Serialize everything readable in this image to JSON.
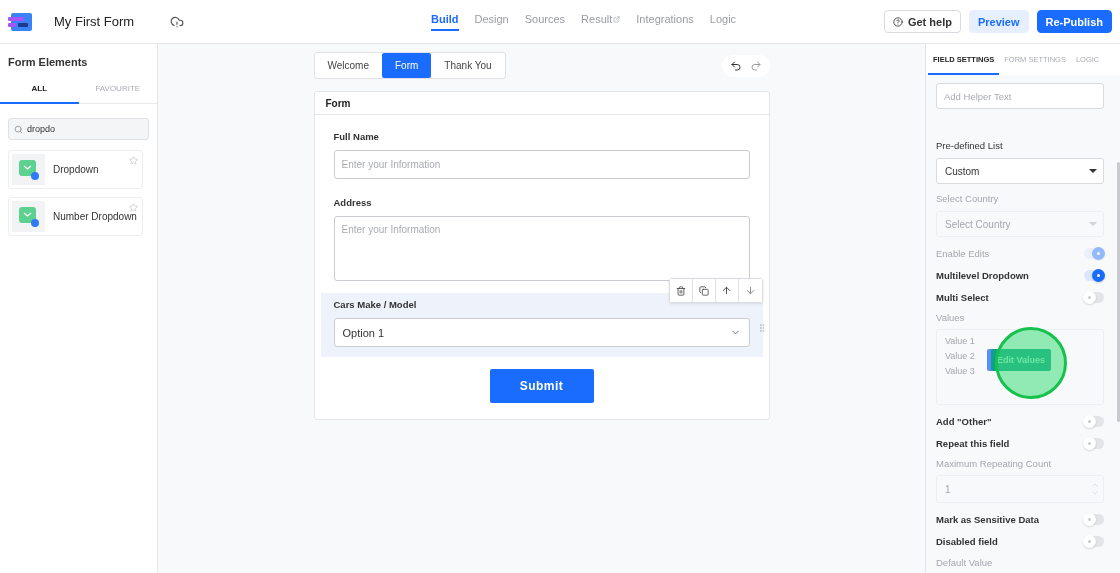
{
  "header": {
    "form_title": "My First Form",
    "nav": [
      {
        "label": "Build",
        "selected": true,
        "external": false
      },
      {
        "label": "Design",
        "selected": false,
        "external": false
      },
      {
        "label": "Sources",
        "selected": false,
        "external": false
      },
      {
        "label": "Result",
        "selected": false,
        "external": true
      },
      {
        "label": "Integrations",
        "selected": false,
        "external": false
      },
      {
        "label": "Logic",
        "selected": false,
        "external": false
      }
    ],
    "buttons": [
      {
        "label": "Get help",
        "kind": "outline"
      },
      {
        "label": "Preview",
        "kind": "soft"
      },
      {
        "label": "Re-Publish",
        "kind": "primary"
      }
    ]
  },
  "sidebar": {
    "title": "Form Elements",
    "tabs": [
      {
        "label": "ALL",
        "selected": true
      },
      {
        "label": "FAVOURITE",
        "selected": false
      }
    ],
    "search": {
      "value": "dropdo"
    },
    "items": [
      {
        "label": "Dropdown"
      },
      {
        "label": "Number Dropdown"
      }
    ]
  },
  "canvas": {
    "steps": [
      {
        "label": "Welcome",
        "selected": false
      },
      {
        "label": "Form",
        "selected": true
      },
      {
        "label": "Thank You",
        "selected": false
      }
    ],
    "form": {
      "title": "Form",
      "fields": [
        {
          "kind": "input",
          "label": "Full Name",
          "placeholder": "Enter your Information",
          "selected": false
        },
        {
          "kind": "textarea",
          "label": "Address",
          "placeholder": "Enter your Information",
          "selected": false
        },
        {
          "kind": "select",
          "label": "Cars Make / Model",
          "value": "Option 1",
          "selected": true
        }
      ],
      "submit": "Submit"
    }
  },
  "settings": {
    "tabs": [
      {
        "label": "FIELD SETTINGS",
        "selected": true
      },
      {
        "label": "FORM SETTINGS",
        "selected": false
      },
      {
        "label": "LOGIC",
        "selected": false
      }
    ],
    "items": [
      {
        "kind": "input",
        "placeholder": "Add Helper Text"
      },
      {
        "kind": "select",
        "label": "Pre-defined List",
        "value": "Custom",
        "disabled": false
      },
      {
        "kind": "select",
        "label": "Select Country",
        "placeholder": "Select Country",
        "disabled": true
      },
      {
        "kind": "toggle",
        "label": "Enable Edits",
        "on": true,
        "disabled": true
      },
      {
        "kind": "toggle",
        "label": "Multilevel Dropdown",
        "on": true,
        "disabled": false
      },
      {
        "kind": "toggle",
        "label": "Multi Select",
        "on": false,
        "disabled": false
      },
      {
        "kind": "values",
        "label": "Values",
        "values": [
          "Value 1",
          "Value 2",
          "Value 3"
        ],
        "button": "Edit Values"
      },
      {
        "kind": "toggle",
        "label": "Add \"Other\"",
        "on": false,
        "disabled": false
      },
      {
        "kind": "toggle",
        "label": "Repeat this field",
        "on": false,
        "disabled": false
      },
      {
        "kind": "number",
        "label": "Maximum Repeating Count",
        "value": "1"
      },
      {
        "kind": "toggle",
        "label": "Mark as Sensitive Data",
        "on": false,
        "disabled": false
      },
      {
        "kind": "toggle",
        "label": "Disabled field",
        "on": false,
        "disabled": false
      },
      {
        "kind": "label",
        "label": "Default Value"
      }
    ]
  }
}
